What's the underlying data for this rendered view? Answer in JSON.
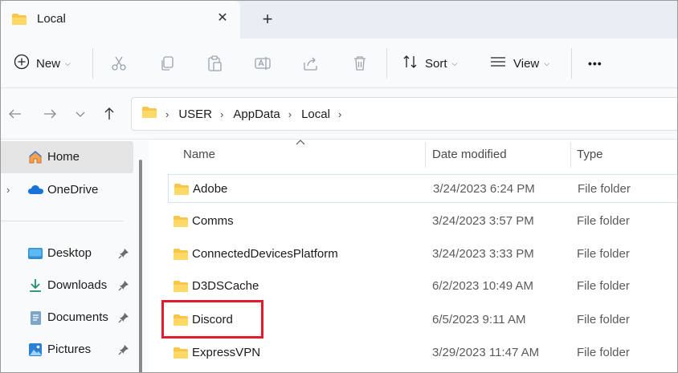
{
  "tab": {
    "title": "Local",
    "close_icon": "close-icon",
    "new_tab": "+"
  },
  "commands": {
    "new_label": "New",
    "sort_label": "Sort",
    "view_label": "View",
    "more_label": "•••"
  },
  "address": {
    "crumbs": [
      "USER",
      "AppData",
      "Local"
    ]
  },
  "sidebar": {
    "items": [
      {
        "label": "Home",
        "icon": "home-icon"
      },
      {
        "label": "OneDrive",
        "icon": "cloud-icon"
      },
      {
        "label": "Desktop",
        "icon": "desktop-icon"
      },
      {
        "label": "Downloads",
        "icon": "download-icon"
      },
      {
        "label": "Documents",
        "icon": "document-icon"
      },
      {
        "label": "Pictures",
        "icon": "picture-icon"
      }
    ]
  },
  "columns": {
    "name": "Name",
    "date": "Date modified",
    "type": "Type"
  },
  "files": [
    {
      "name": "Adobe",
      "date": "3/24/2023 6:24 PM",
      "type": "File folder"
    },
    {
      "name": "Comms",
      "date": "3/24/2023 3:57 PM",
      "type": "File folder"
    },
    {
      "name": "ConnectedDevicesPlatform",
      "date": "3/24/2023 3:33 PM",
      "type": "File folder"
    },
    {
      "name": "D3DSCache",
      "date": "6/2/2023 10:49 AM",
      "type": "File folder"
    },
    {
      "name": "Discord",
      "date": "6/5/2023 9:11 AM",
      "type": "File folder"
    },
    {
      "name": "ExpressVPN",
      "date": "3/29/2023 11:47 AM",
      "type": "File folder"
    }
  ],
  "colors": {
    "folder": "#f8c64a",
    "highlight": "#e21b2d",
    "accent": "#0067c0"
  }
}
